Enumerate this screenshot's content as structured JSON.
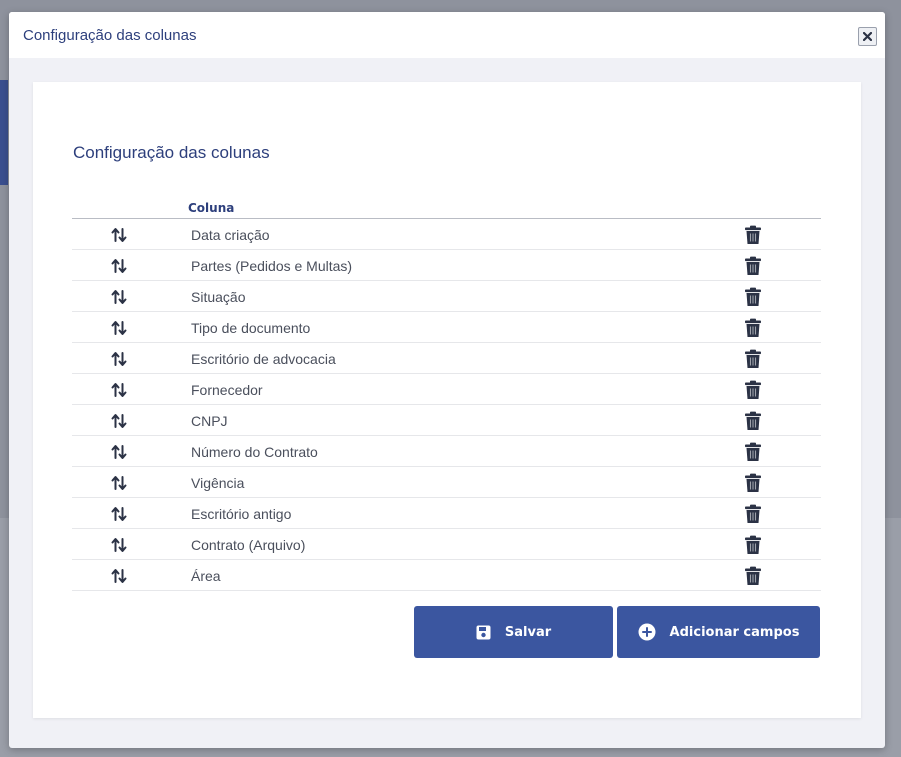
{
  "modal": {
    "title": "Configuração das colunas",
    "close_icon": "close-icon"
  },
  "card": {
    "title": "Configuração das colunas"
  },
  "table": {
    "header": "Coluna",
    "rows": [
      "Data criação",
      "Partes (Pedidos e Multas)",
      "Situação",
      "Tipo de documento",
      "Escritório de advocacia",
      "Fornecedor",
      "CNPJ",
      "Número do Contrato",
      "Vigência",
      "Escritório antigo",
      "Contrato (Arquivo)",
      "Área"
    ]
  },
  "buttons": {
    "save_label": "Salvar",
    "save_icon": "floppy-disk-icon",
    "add_label": "Adicionar campos",
    "add_icon": "plus-circle-icon"
  },
  "colors": {
    "primary": "#3b56a0",
    "title": "#2d3f7c",
    "icon": "#2b3245"
  }
}
